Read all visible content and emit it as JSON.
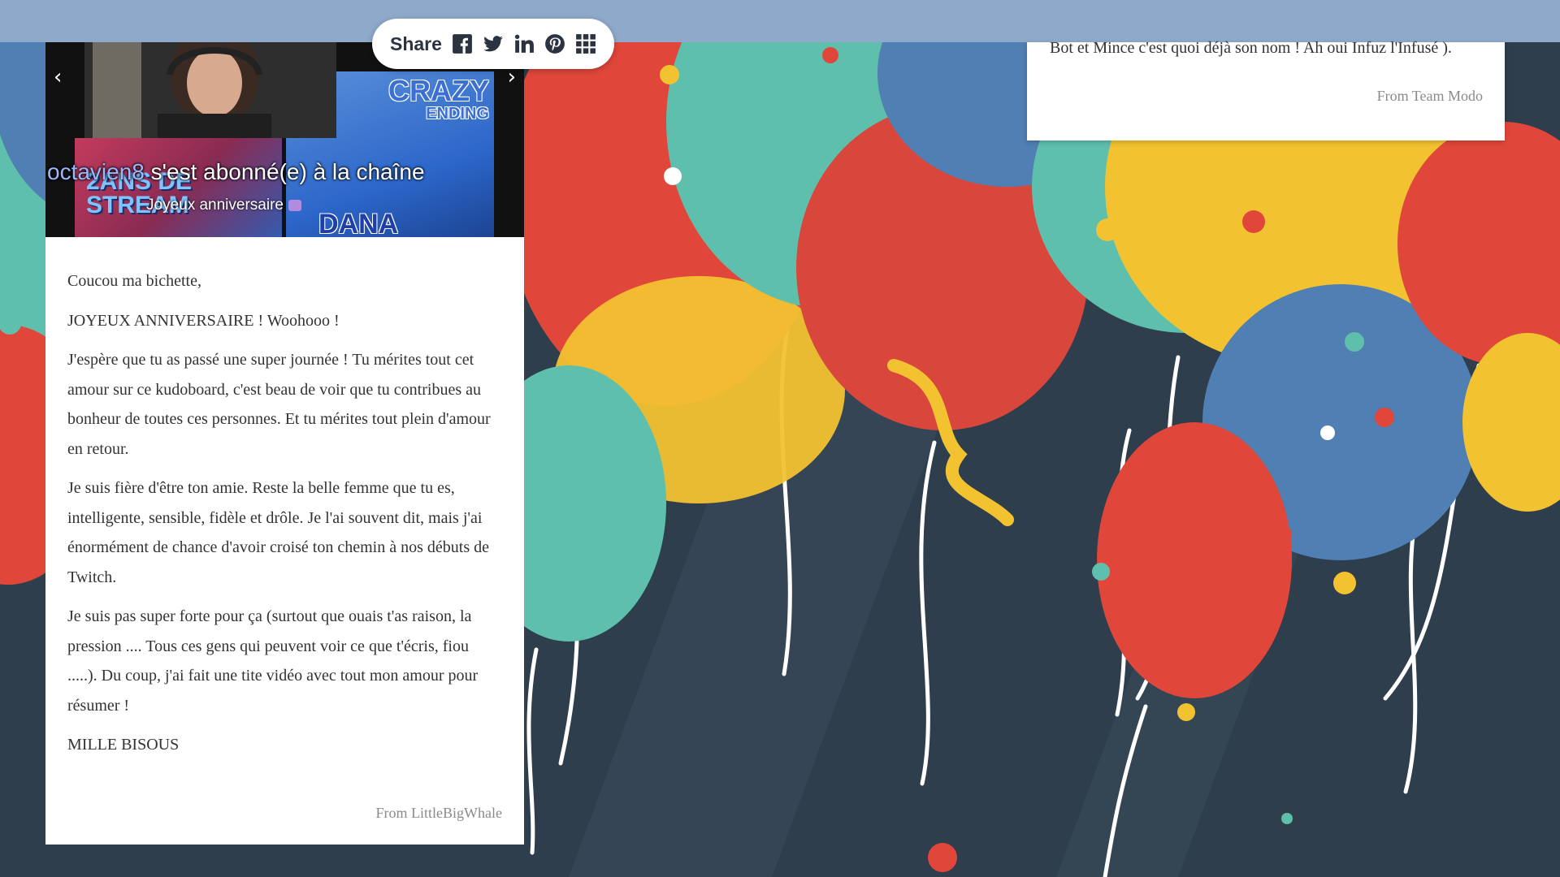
{
  "share": {
    "label": "Share",
    "icons": [
      "facebook-icon",
      "twitter-icon",
      "linkedin-icon",
      "pinterest-icon",
      "grid-icon"
    ]
  },
  "video_post": {
    "prev_icon": "chevron-left-icon",
    "next_icon": "chevron-right-icon",
    "prev_glyph": "‹",
    "next_glyph": "›",
    "left_thumb_text": "2ANS DE STREAM",
    "right_thumb_title_1": "CRAZY",
    "right_thumb_title_2": "ENDING",
    "right_thumb_name": "DANA",
    "overlay_username": "octavien8",
    "overlay_text": " s'est abonné(e) à la chaîne",
    "overlay_caption": "Joyeux anniversaire"
  },
  "message_post": {
    "paragraphs": [
      "Coucou ma bichette,",
      "JOYEUX ANNIVERSAIRE ! Woohooo !",
      "J'espère que tu as passé une super journée ! Tu mérites tout cet amour sur ce kudoboard, c'est beau de voir que tu contribues au bonheur de toutes ces personnes. Et tu mérites tout plein d'amour en retour.",
      "Je suis fière d'être ton amie. Reste la belle femme que tu es, intelligente, sensible, fidèle et drôle. Je l'ai souvent dit, mais j'ai énormément de chance d'avoir croisé ton chemin à nos débuts de Twitch.",
      "Je suis pas super forte pour ça (surtout que ouais t'as raison, la pression .... Tous ces gens qui peuvent voir ce que t'écris, fiou .....). Du coup, j'ai fait une tite vidéo avec tout mon amour pour résumer !",
      "MILLE BISOUS"
    ],
    "from": "From LittleBigWhale"
  },
  "modo_post": {
    "text": "Bot et Mince c'est quoi déjà son nom ! Ah oui Infuz l'Infusé ).",
    "from": "From Team Modo"
  },
  "colors": {
    "background": "#2f3e4c",
    "top_bar": "#8fa9cb",
    "card": "#ffffff",
    "text": "#333333",
    "muted": "#8a8a8a",
    "balloon_red": "#e0473a",
    "balloon_yellow": "#f2c230",
    "balloon_teal": "#5fbfad",
    "balloon_blue": "#4f7fb3"
  }
}
